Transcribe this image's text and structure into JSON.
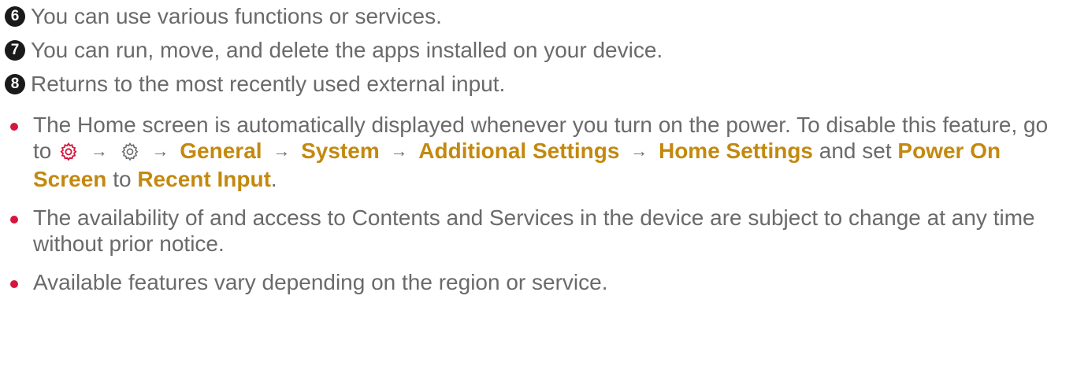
{
  "numbered": [
    {
      "num": "6",
      "text": "You can use various functions or services."
    },
    {
      "num": "7",
      "text": "You can run, move, and delete the apps installed on your device."
    },
    {
      "num": "8",
      "text": "Returns to the most recently used external input."
    }
  ],
  "bullet1": {
    "lead": "The Home screen is automatically displayed whenever you turn on the power. To disable this feature, go to",
    "path": [
      "General",
      "System",
      "Additional Settings",
      "Home Settings"
    ],
    "and_set": "and set",
    "option": "Power On Screen",
    "to": "to",
    "value": "Recent Input",
    "period": ".",
    "arrow": "→",
    "icons": [
      "settings-quick-icon",
      "settings-all-icon"
    ]
  },
  "bullet2": "The availability of and access to Contents and Services in the device are subject to change at any time without prior notice.",
  "bullet3": "Available features vary depending on the region or service.",
  "colors": {
    "text": "#6a6a6a",
    "highlight": "#c3890f",
    "bullet": "#d6163e",
    "badge": "#1a1a1a"
  }
}
